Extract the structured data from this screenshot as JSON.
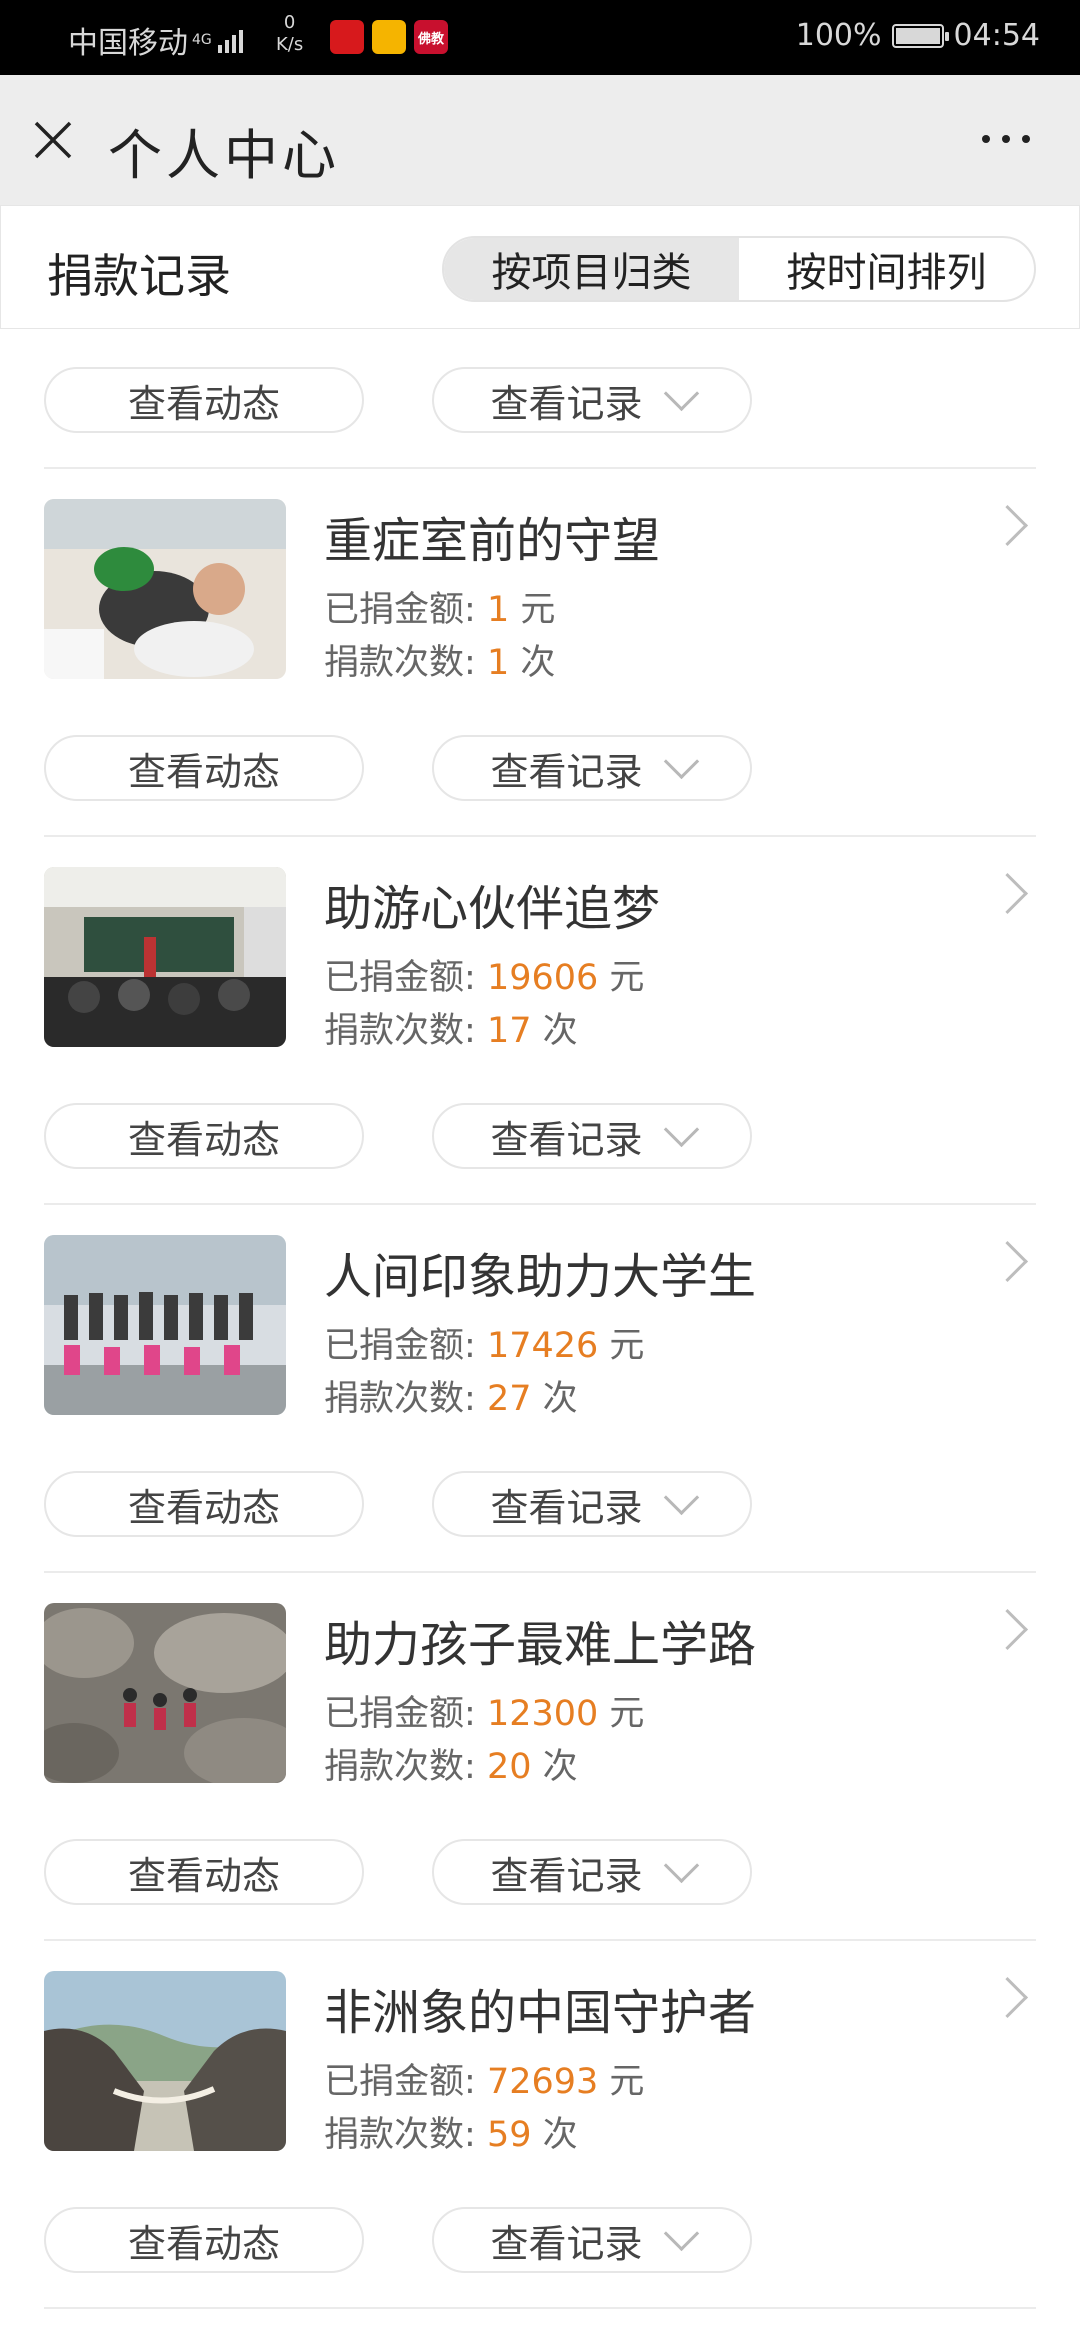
{
  "status": {
    "carrier": "中国移动",
    "network": "4G",
    "speed_value": "0",
    "speed_unit": "K/s",
    "apps": [
      {
        "name": "china-merchants-bank-icon",
        "text": "",
        "color": "#d7191c"
      },
      {
        "name": "yellow-app-icon",
        "text": "",
        "color": "#f5b400"
      },
      {
        "name": "buddhism-app-icon",
        "text": "佛教",
        "color": "#c8102e"
      }
    ],
    "battery": "100%",
    "battery_level": 1.0,
    "time": "04:54"
  },
  "titlebar": {
    "title": "个人中心"
  },
  "header": {
    "title": "捐款记录",
    "tabs": [
      {
        "label": "按项目归类",
        "active": true
      },
      {
        "label": "按时间排列",
        "active": false
      }
    ]
  },
  "actions": {
    "view_updates": "查看动态",
    "view_records": "查看记录"
  },
  "labels": {
    "amount": "已捐金额:",
    "count": "捐款次数:",
    "yuan": "元",
    "times": "次"
  },
  "projects": [
    {
      "title": "重症室前的守望",
      "amount": "1",
      "count": "1"
    },
    {
      "title": "助游心伙伴追梦",
      "amount": "19606",
      "count": "17"
    },
    {
      "title": "人间印象助力大学生",
      "amount": "17426",
      "count": "27"
    },
    {
      "title": "助力孩子最难上学路",
      "amount": "12300",
      "count": "20"
    },
    {
      "title": "非洲象的中国守护者",
      "amount": "72693",
      "count": "59"
    }
  ],
  "accent_color": "#e67e22"
}
